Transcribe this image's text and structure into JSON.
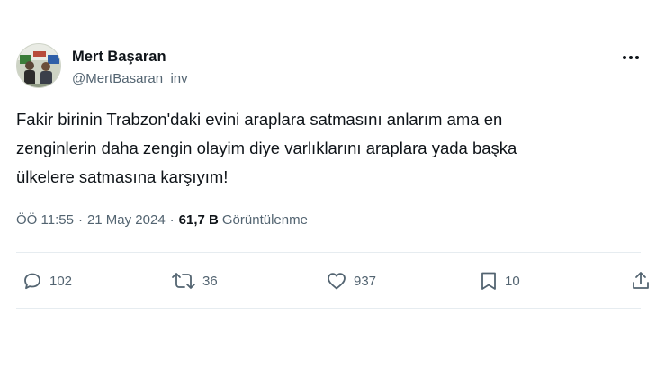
{
  "author": {
    "name": "Mert Başaran",
    "handle": "@MertBasaran_inv"
  },
  "tweet": {
    "lines": [
      "Fakir birinin Trabzon'daki evini araplara satmasını anlarım ama en",
      "zenginlerin daha zengin olayim diye varlıklarını araplara yada başka",
      "ülkelere satmasına karşıyım!"
    ]
  },
  "meta": {
    "time": "ÖÖ 11:55",
    "separator": "·",
    "date": "21 May 2024",
    "views_count": "61,7 B",
    "views_label": "Görüntülenme"
  },
  "actions": {
    "reply_count": "102",
    "retweet_count": "36",
    "like_count": "937",
    "bookmark_count": "10"
  },
  "icons": {
    "more": "more-horizontal-icon",
    "reply": "reply-icon",
    "retweet": "retweet-icon",
    "like": "heart-icon",
    "bookmark": "bookmark-icon",
    "share": "share-icon"
  },
  "colors": {
    "text": "#0f1419",
    "secondary": "#536471",
    "divider": "#e6ecf0"
  }
}
